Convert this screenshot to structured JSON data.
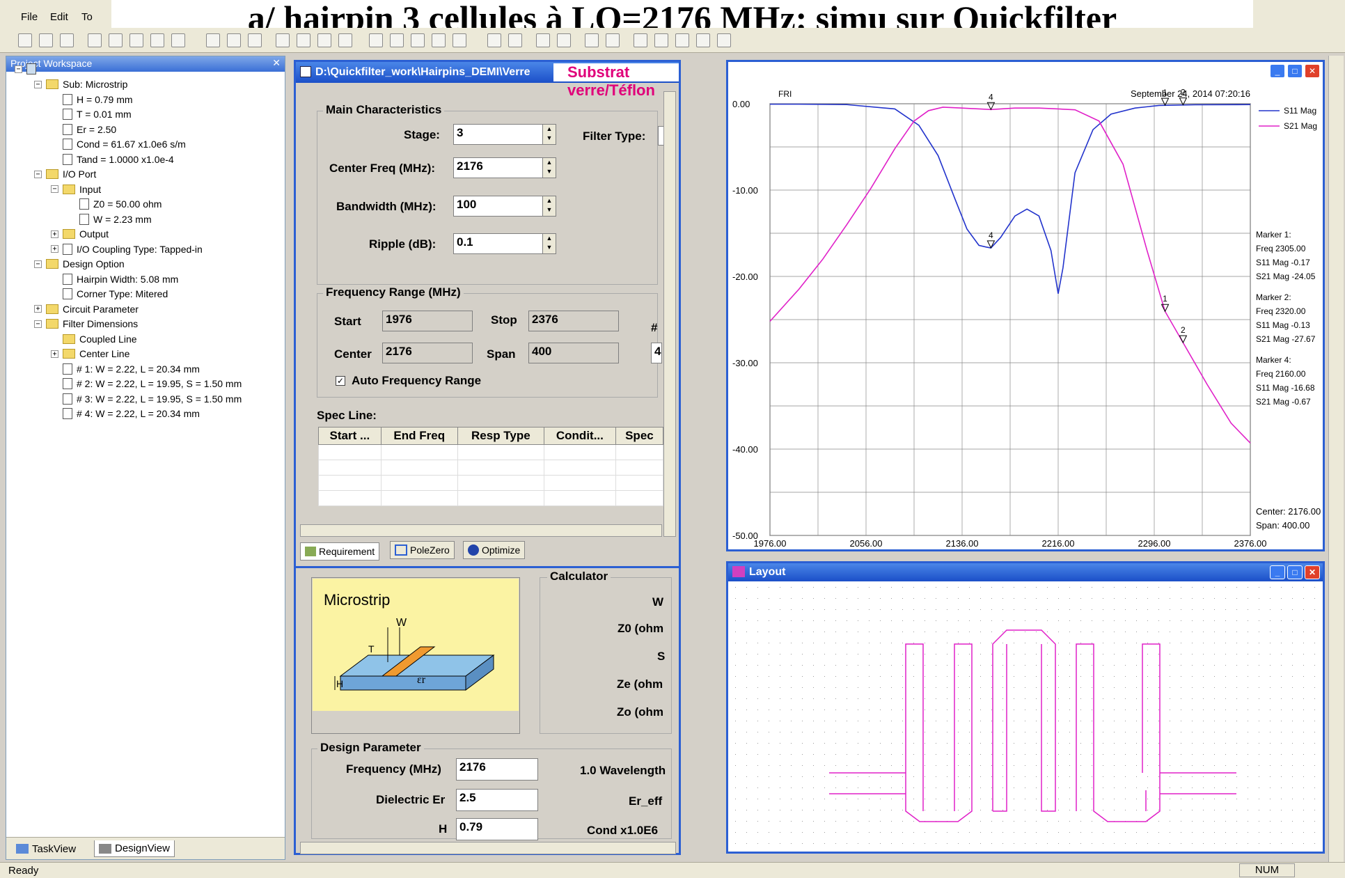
{
  "banner": "a/ hairpin 3 cellules à LO=2176 MHz: simu sur Quickfilter",
  "menu": {
    "file": "File",
    "edit": "Edit",
    "tools": "To"
  },
  "workspace": {
    "title": "Project Workspace",
    "tree": [
      {
        "label": "Sub: Microstrip",
        "level": 1,
        "kind": "folder",
        "expander": "−"
      },
      {
        "label": "H = 0.79 mm",
        "level": 2,
        "kind": "leaf"
      },
      {
        "label": "T = 0.01 mm",
        "level": 2,
        "kind": "leaf"
      },
      {
        "label": "Er = 2.50",
        "level": 2,
        "kind": "leaf"
      },
      {
        "label": "Cond = 61.67 x1.0e6 s/m",
        "level": 2,
        "kind": "leaf"
      },
      {
        "label": "Tand = 1.0000 x1.0e-4",
        "level": 2,
        "kind": "leaf"
      },
      {
        "label": "I/O Port",
        "level": 1,
        "kind": "folder",
        "expander": "−"
      },
      {
        "label": "Input",
        "level": 2,
        "kind": "folder",
        "expander": "−"
      },
      {
        "label": "Z0 = 50.00 ohm",
        "level": 3,
        "kind": "leaf"
      },
      {
        "label": "W = 2.23 mm",
        "level": 3,
        "kind": "leaf"
      },
      {
        "label": "Output",
        "level": 2,
        "kind": "folder",
        "expander": "+"
      },
      {
        "label": "I/O Coupling Type: Tapped-in",
        "level": 2,
        "kind": "leaf",
        "expander": "+"
      },
      {
        "label": "Design Option",
        "level": 1,
        "kind": "folder",
        "expander": "−"
      },
      {
        "label": "Hairpin Width: 5.08 mm",
        "level": 2,
        "kind": "leaf"
      },
      {
        "label": "Corner Type: Mitered",
        "level": 2,
        "kind": "leaf"
      },
      {
        "label": "Circuit Parameter",
        "level": 1,
        "kind": "folder",
        "expander": "+"
      },
      {
        "label": "Filter Dimensions",
        "level": 1,
        "kind": "folder",
        "expander": "−"
      },
      {
        "label": "Coupled Line",
        "level": 2,
        "kind": "folder"
      },
      {
        "label": "Center Line",
        "level": 2,
        "kind": "folder",
        "expander": "+"
      },
      {
        "label": "# 1: W = 2.22,  L = 20.34 mm",
        "level": 2,
        "kind": "leaf"
      },
      {
        "label": "# 2: W = 2.22,  L = 19.95,  S = 1.50 mm",
        "level": 2,
        "kind": "leaf"
      },
      {
        "label": "# 3: W = 2.22,  L = 19.95,  S = 1.50 mm",
        "level": 2,
        "kind": "leaf"
      },
      {
        "label": "# 4: W = 2.22,  L = 20.34 mm",
        "level": 2,
        "kind": "leaf"
      }
    ],
    "tabs": {
      "taskview": "TaskView",
      "designview": "DesignView"
    }
  },
  "req": {
    "title": "D:\\Quickfilter_work\\Hairpins_DEMI\\Verre",
    "substrat": "Substrat verre/Téflon",
    "main_group": "Main Characteristics",
    "stage_label": "Stage:",
    "stage": "3",
    "filter_type_label": "Filter Type:",
    "center_label": "Center Freq (MHz):",
    "center": "2176",
    "bw_label": "Bandwidth (MHz):",
    "bw": "100",
    "ripple_label": "Ripple (dB):",
    "ripple": "0.1",
    "freq_group": "Frequency Range (MHz)",
    "start_label": "Start",
    "start": "1976",
    "stop_label": "Stop",
    "stop": "2376",
    "hash_label": "#",
    "hash_val": "4",
    "centerf_label": "Center",
    "centerf": "2176",
    "span_label": "Span",
    "span": "400",
    "auto_label": "Auto Frequency Range",
    "spec_label": "Spec Line:",
    "spec_cols": [
      "Start ...",
      "End Freq",
      "Resp Type",
      "Condit...",
      "Spec"
    ],
    "tabs": {
      "requirement": "Requirement",
      "polezero": "PoleZero",
      "optimize": "Optimize"
    },
    "microstrip": "Microstrip",
    "calc_group": "Calculator",
    "calc_w": "W",
    "calc_z0": "Z0 (ohm",
    "calc_s": "S",
    "calc_ze": "Ze (ohm",
    "calc_zo": "Zo (ohm",
    "design_group": "Design Parameter",
    "dp_freq_label": "Frequency (MHz)",
    "dp_freq": "2176",
    "dp_er_label": "Dielectric Er",
    "dp_er": "2.5",
    "dp_h_label": "H",
    "dp_h": "0.79",
    "wavelength": "1.0 Wavelength",
    "er_eff": "Er_eff",
    "cond": "Cond x1.0E6"
  },
  "chart_title_fri": "FRI",
  "chart_date": "September 24, 2014  07:20:16",
  "layout_title": "Layout",
  "status": {
    "ready": "Ready",
    "num": "NUM"
  },
  "markers_text": {
    "m1_title": "Marker 1:",
    "m1_freq": "Freq      2305.00",
    "m1_s11": "S11 Mag  -0.17",
    "m1_s21": "S21 Mag  -24.05",
    "m2_title": "Marker 2:",
    "m2_freq": "Freq      2320.00",
    "m2_s11": "S11 Mag  -0.13",
    "m2_s21": "S21 Mag  -27.67",
    "m4_title": "Marker 4:",
    "m4_freq": "Freq      2160.00",
    "m4_s11": "S11 Mag  -16.68",
    "m4_s21": "S21 Mag  -0.67",
    "center": "Center: 2176.00",
    "span": "Span:   400.00"
  },
  "chart_data": {
    "type": "line",
    "xlim": [
      1976,
      2376
    ],
    "ylim": [
      -50,
      0
    ],
    "x_ticks": [
      1976,
      2056,
      2136,
      2216,
      2296,
      2376
    ],
    "x_tick_labels": [
      "1976.00",
      "2056.00",
      "2136.00",
      "2216.00",
      "2296.00",
      "2376.00"
    ],
    "y_ticks": [
      0,
      -10,
      -20,
      -30,
      -40,
      -50
    ],
    "y_tick_labels": [
      "0.00",
      "-10.00",
      "-20.00",
      "-30.00",
      "-40.00",
      "-50.00"
    ],
    "grid": true,
    "legend_position": "top-right",
    "series": [
      {
        "name": "S11 Mag",
        "color": "#2233cc",
        "x": [
          1976,
          2000,
          2040,
          2080,
          2100,
          2116,
          2130,
          2140,
          2150,
          2156,
          2160,
          2168,
          2180,
          2190,
          2200,
          2210,
          2216,
          2220,
          2230,
          2245,
          2260,
          2280,
          2300,
          2330,
          2376
        ],
        "y": [
          -0.05,
          -0.05,
          -0.1,
          -0.6,
          -2.5,
          -6,
          -11,
          -14.5,
          -16.4,
          -16.6,
          -16.7,
          -15.5,
          -13,
          -12.2,
          -13,
          -17,
          -22,
          -19,
          -8,
          -3,
          -1.2,
          -0.5,
          -0.2,
          -0.12,
          -0.1
        ]
      },
      {
        "name": "S21 Mag",
        "color": "#e020c8",
        "x": [
          1976,
          2000,
          2020,
          2040,
          2060,
          2080,
          2096,
          2108,
          2120,
          2136,
          2160,
          2180,
          2200,
          2216,
          2230,
          2250,
          2270,
          2290,
          2305,
          2320,
          2340,
          2360,
          2376
        ],
        "y": [
          -25.2,
          -21.5,
          -18,
          -14,
          -9.8,
          -5.2,
          -2,
          -0.8,
          -0.4,
          -0.5,
          -0.67,
          -0.5,
          -0.5,
          -0.6,
          -0.7,
          -2,
          -7,
          -17,
          -24.05,
          -27.67,
          -32.5,
          -37,
          -39.3
        ]
      }
    ],
    "markers": [
      {
        "label": "4",
        "x": 2160,
        "y": -16.68
      },
      {
        "label": "4",
        "x": 2160,
        "y": -0.67
      },
      {
        "label": "1",
        "x": 2305,
        "y": -24.05
      },
      {
        "label": "2",
        "x": 2320,
        "y": -27.67
      },
      {
        "label": "1",
        "x": 2305,
        "y": -0.17
      },
      {
        "label": "2",
        "x": 2320,
        "y": -0.13
      }
    ]
  }
}
